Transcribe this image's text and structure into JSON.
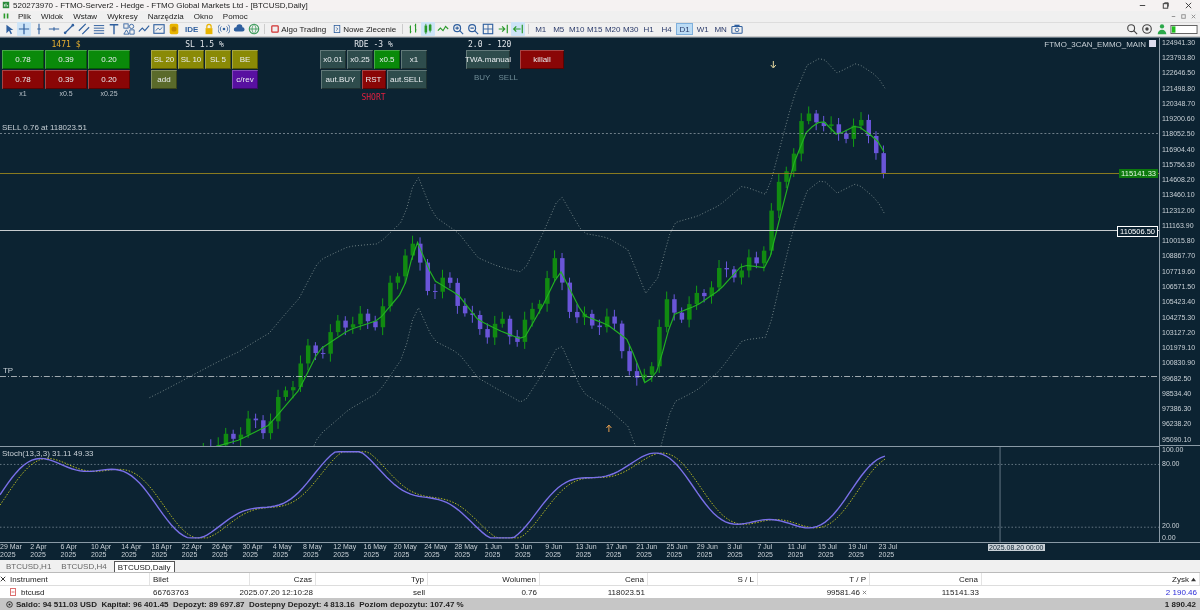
{
  "window": {
    "title": "520273970 - FTMO-Server2 - Hedge - FTMO Global Markets Ltd - [BTCUSD,Daily]"
  },
  "menu": [
    "Plik",
    "Widok",
    "Wstaw",
    "Wykresy",
    "Narzędzia",
    "Okno",
    "Pomoc"
  ],
  "toolbar": {
    "ide_label": "IDE",
    "algo_trading": "Algo Trading",
    "new_order": "Nowe Zlecenie",
    "timeframes": [
      {
        "label": "M1",
        "selected": false
      },
      {
        "label": "M5",
        "selected": false
      },
      {
        "label": "M10",
        "selected": false
      },
      {
        "label": "M15",
        "selected": false
      },
      {
        "label": "M20",
        "selected": false
      },
      {
        "label": "M30",
        "selected": false
      },
      {
        "label": "H1",
        "selected": false
      },
      {
        "label": "H4",
        "selected": false
      },
      {
        "label": "D1",
        "selected": true
      },
      {
        "label": "W1",
        "selected": false
      },
      {
        "label": "MN",
        "selected": false
      }
    ]
  },
  "chart": {
    "indicator_name": "FTMO_3CAN_EMMO_MAIN",
    "price_axis": [
      "124941.30",
      "123793.80",
      "122646.50",
      "121498.80",
      "120348.70",
      "119200.60",
      "118052.50",
      "116904.40",
      "115756.30",
      "114608.20",
      "113460.10",
      "112312.00",
      "111163.90",
      "110015.80",
      "108867.70",
      "107719.60",
      "106571.50",
      "105423.40",
      "104275.30",
      "103127.20",
      "101979.10",
      "100830.90",
      "99682.50",
      "98534.40",
      "97386.30",
      "96238.20",
      "95090.10"
    ],
    "current_price": "115141.33",
    "line_price": "110506.50",
    "position_label": "SELL 0.76 at 118023.51",
    "tp_label": "TP",
    "stoch": {
      "label": "Stoch(13,3,3) 31.11 49.33",
      "axis": [
        "100.00",
        "80.00",
        "20.00",
        "0.00"
      ]
    },
    "time_axis": [
      "29 Mar 2025",
      "2 Apr 2025",
      "6 Apr 2025",
      "10 Apr 2025",
      "14 Apr 2025",
      "18 Apr 2025",
      "22 Apr 2025",
      "26 Apr 2025",
      "30 Apr 2025",
      "4 May 2025",
      "8 May 2025",
      "12 May 2025",
      "16 May 2025",
      "20 May 2025",
      "24 May 2025",
      "28 May 2025",
      "1 Jun 2025",
      "5 Jun 2025",
      "9 Jun 2025",
      "13 Jun 2025",
      "17 Jun 2025",
      "21 Jun 2025",
      "25 Jun 2025",
      "29 Jun 2025",
      "3 Jul 2025",
      "7 Jul 2025",
      "11 Jul 2025",
      "15 Jul 2025",
      "19 Jul 2025",
      "23 Jul 2025"
    ],
    "cursor_time": "2025.08.20 00:00"
  },
  "panel": {
    "lots": {
      "header": "1471 $",
      "rows": [
        {
          "kind": "buy",
          "buttons": [
            "0.78",
            "0.39",
            "0.20"
          ]
        },
        {
          "kind": "sell",
          "buttons": [
            "0.78",
            "0.39",
            "0.20"
          ]
        }
      ],
      "notes": [
        "x1",
        "x0.5",
        "x0.25"
      ]
    },
    "stop_loss": {
      "header": "SL 1.5 %",
      "rows": [
        [
          {
            "label": "SL 20",
            "kind": "olive"
          },
          {
            "label": "SL 10",
            "kind": "olive"
          },
          {
            "label": "SL 5",
            "kind": "olive"
          },
          {
            "label": "BE",
            "kind": "olive"
          }
        ],
        [
          {
            "label": "add",
            "kind": "moss"
          },
          "",
          "",
          {
            "label": "c/rev",
            "kind": "violet"
          }
        ]
      ]
    },
    "risk": {
      "header": "RDE -3 %",
      "multipliers": [
        {
          "label": "x0.01",
          "kind": "slate"
        },
        {
          "label": "x0.25",
          "kind": "slate"
        },
        {
          "label": "x0.5",
          "kind": "green"
        },
        {
          "label": "x1",
          "kind": "slate"
        }
      ],
      "actions": [
        {
          "label": "aut.BUY",
          "kind": "slate"
        },
        {
          "label": "RST",
          "kind": "red"
        },
        {
          "label": "aut.SELL",
          "kind": "slate"
        }
      ],
      "status": "SHORT"
    },
    "manual": {
      "header": "2.0 - 120",
      "buttons": [
        {
          "label": "TWA.manual",
          "kind": "slate"
        },
        {
          "label": "killall",
          "kind": "red"
        }
      ],
      "sides": [
        {
          "label": "BUY",
          "disabled": true
        },
        {
          "label": "SELL",
          "disabled": true
        }
      ]
    }
  },
  "tabs": [
    {
      "label": "BTCUSD,H1",
      "selected": false
    },
    {
      "label": "BTCUSD,H4",
      "selected": false
    },
    {
      "label": "BTCUSD,Daily",
      "selected": true
    }
  ],
  "trades": {
    "columns": [
      "Instrument",
      "Bilet",
      "Czas",
      "Typ",
      "Wolumen",
      "Cena",
      "S / L",
      "T / P",
      "Cena",
      "Zysk"
    ],
    "rows": [
      {
        "instrument": "btcusd",
        "ticket": "66763763",
        "time": "2025.07.20 12:10:28",
        "type": "sell",
        "volume": "0.76",
        "price": "118023.51",
        "tp": "99581.46",
        "current_price": "115141.33",
        "profit": "2 190.46"
      }
    ],
    "summary": "Saldo: 94 511.03 USD  Kapitał: 96 401.45  Depozyt: 89 697.87  Dostepny Depozyt: 4 813.16  Poziom depozytu: 107.47 %",
    "total": "1 890.42"
  }
}
